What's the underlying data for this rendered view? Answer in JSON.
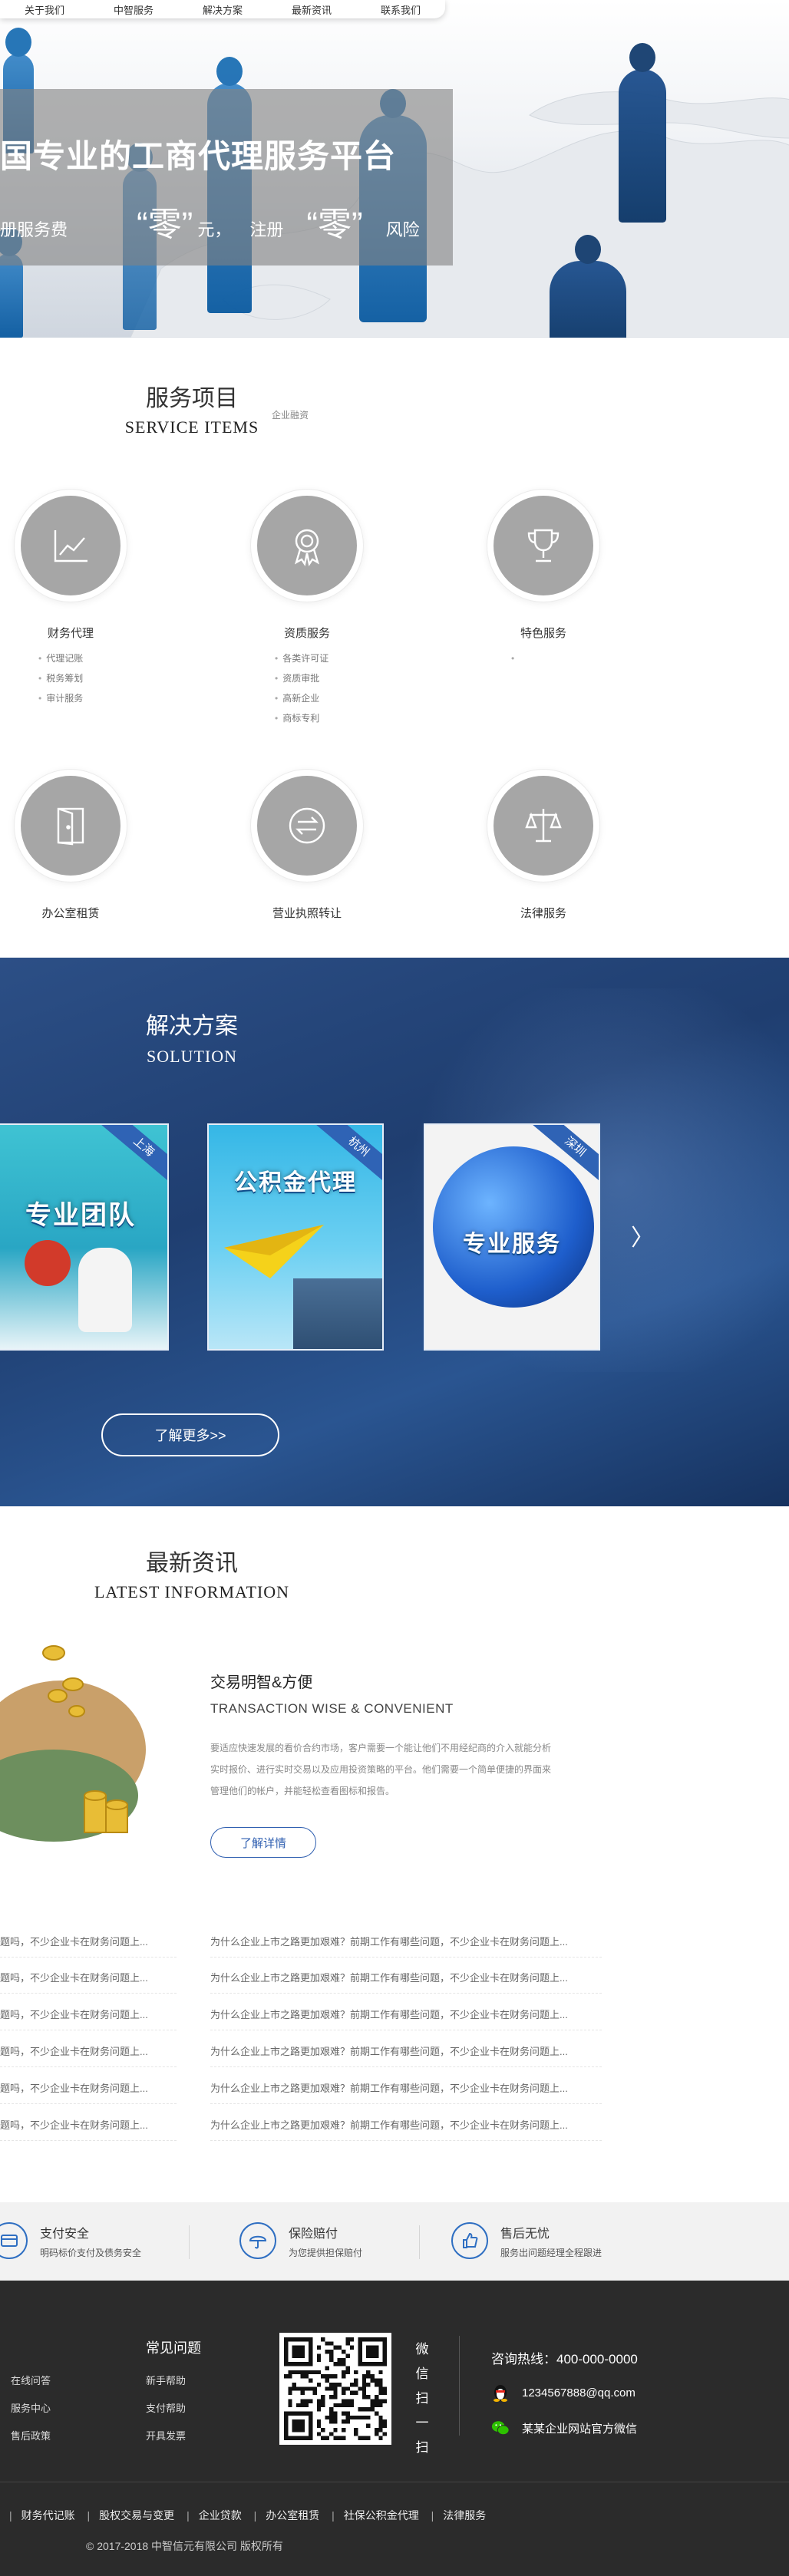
{
  "nav": [
    "关于我们",
    "中智服务",
    "解决方案",
    "最新资讯",
    "联系我们"
  ],
  "hero": {
    "title": "国专业的工商代理服务平台",
    "sub_1": "册服务费",
    "quote_1": "“零”",
    "sub_2": "元，",
    "sub_3": "注册",
    "quote_2": "“零”",
    "sub_4": "风险"
  },
  "services_section": {
    "title_cn": "服务项目",
    "title_en": "SERVICE ITEMS",
    "side_tag": "企业融资",
    "items": [
      {
        "name": "财务代理",
        "icon": "chart-icon",
        "subs": [
          "代理记账",
          "税务筹划",
          "审计服务"
        ]
      },
      {
        "name": "资质服务",
        "icon": "medal-icon",
        "subs": [
          "各类许可证",
          "资质审批",
          "高新企业",
          "商标专利"
        ]
      },
      {
        "name": "特色服务",
        "icon": "trophy-icon",
        "subs": [
          ""
        ]
      },
      {
        "name": "办公室租赁",
        "icon": "door-icon",
        "subs": []
      },
      {
        "name": "营业执照转让",
        "icon": "transfer-icon",
        "subs": []
      },
      {
        "name": "法律服务",
        "icon": "scales-icon",
        "subs": []
      }
    ]
  },
  "solution": {
    "title_cn": "解决方案",
    "title_en": "SOLUTION",
    "cards": [
      {
        "city": "上海",
        "text": "专业团队"
      },
      {
        "city": "杭州",
        "text": "公积金代理"
      },
      {
        "city": "深圳",
        "text": "专业服务"
      }
    ],
    "next_arrow": "〉",
    "more": "了解更多>>"
  },
  "news": {
    "title_cn": "最新资讯",
    "title_en": "LATEST INFORMATION",
    "feature_title": "交易明智&方便",
    "feature_en": "TRANSACTION WISE & CONVENIENT",
    "feature_desc": "要适应快速发展的看价合约市场，客户需要一个能让他们不用经纪商的介入就能分析实时报价、进行实时交易以及应用投资策略的平台。他们需要一个简单便捷的界面来管理他们的帐户，并能轻松查看图标和报告。",
    "feature_btn": "了解详情",
    "left_items": [
      "题吗，不少企业卡在财务问题上...",
      "题吗，不少企业卡在财务问题上...",
      "题吗，不少企业卡在财务问题上...",
      "题吗，不少企业卡在财务问题上...",
      "题吗，不少企业卡在财务问题上...",
      "题吗，不少企业卡在财务问题上..."
    ],
    "right_items": [
      "为什么企业上市之路更加艰难？前期工作有哪些问题，不少企业卡在财务问题上...",
      "为什么企业上市之路更加艰难？前期工作有哪些问题，不少企业卡在财务问题上...",
      "为什么企业上市之路更加艰难？前期工作有哪些问题，不少企业卡在财务问题上...",
      "为什么企业上市之路更加艰难？前期工作有哪些问题，不少企业卡在财务问题上...",
      "为什么企业上市之路更加艰难？前期工作有哪些问题，不少企业卡在财务问题上...",
      "为什么企业上市之路更加艰难？前期工作有哪些问题，不少企业卡在财务问题上..."
    ]
  },
  "guarantee": [
    {
      "title": "支付安全",
      "desc": "明码标价支付及债务安全",
      "icon": "card-icon"
    },
    {
      "title": "保险赔付",
      "desc": "为您提供担保赔付",
      "icon": "umbrella-icon"
    },
    {
      "title": "售后无忧",
      "desc": "服务出问题经理全程跟进",
      "icon": "thumbs-up-icon"
    }
  ],
  "footer": {
    "faq_title": "常见问题",
    "col1": [
      "在线问答",
      "服务中心",
      "售后政策"
    ],
    "col2": [
      "新手帮助",
      "支付帮助",
      "开具发票"
    ],
    "scan": [
      "微",
      "信",
      "扫",
      "一",
      "扫"
    ],
    "hotline": "咨询热线：400-000-0000",
    "qq": "1234567888@qq.com",
    "wechat": "某某企业网站官方微信",
    "bottom_links": [
      "财务代记账",
      "股权交易与变更",
      "企业贷款",
      "办公室租赁",
      "社保公积金代理",
      "法律服务"
    ],
    "copyright": "© 2017-2018 中智信元有限公司 版权所有"
  },
  "colors": {
    "accent": "#2f5fb0",
    "solution_bg": "#23467d",
    "footer_bg": "#2b2b2b",
    "service_disc": "#a6a6a6"
  }
}
